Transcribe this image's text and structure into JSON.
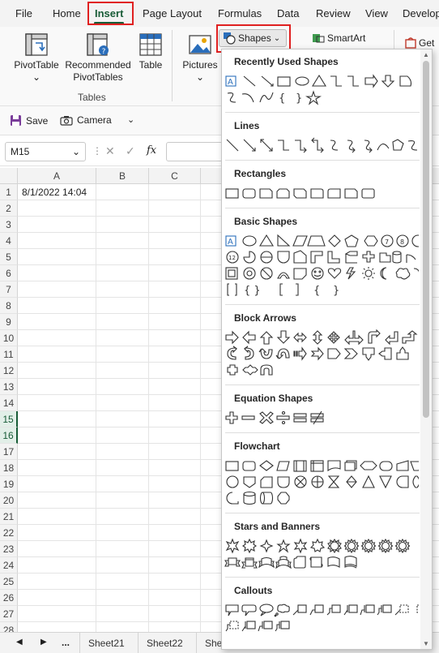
{
  "menu": {
    "file": "File",
    "home": "Home",
    "insert": "Insert",
    "page_layout": "Page Layout",
    "formulas": "Formulas",
    "data": "Data",
    "review": "Review",
    "view": "View",
    "developer": "Develop"
  },
  "ribbon": {
    "pivottable": "PivotTable",
    "recommended_1": "Recommended",
    "recommended_2": "PivotTables",
    "table": "Table",
    "tables_group": "Tables",
    "pictures": "Pictures",
    "shapes": "Shapes",
    "smartart": "SmartArt",
    "get": "Get"
  },
  "qat": {
    "save": "Save",
    "camera": "Camera"
  },
  "formula_bar": {
    "name_box": "M15",
    "fx": "fx"
  },
  "grid": {
    "columns": [
      "A",
      "B",
      "C"
    ],
    "rows": [
      "1",
      "2",
      "3",
      "4",
      "5",
      "6",
      "7",
      "8",
      "9",
      "10",
      "11",
      "12",
      "13",
      "14",
      "15",
      "16",
      "17",
      "18",
      "19",
      "20",
      "21",
      "22",
      "23",
      "24",
      "25",
      "26",
      "27",
      "28"
    ],
    "selected_rows": [
      "15",
      "16"
    ],
    "cell_a1": "8/1/2022 14:04"
  },
  "sheet_tabs": {
    "ellipsis": "...",
    "tabs": [
      "Sheet21",
      "Sheet22",
      "She"
    ]
  },
  "shapes_panel": {
    "sections": [
      "Recently Used Shapes",
      "Lines",
      "Rectangles",
      "Basic Shapes",
      "Block Arrows",
      "Equation Shapes",
      "Flowchart",
      "Stars and Banners",
      "Callouts"
    ]
  },
  "colors": {
    "excel_green": "#185c37",
    "highlight_red": "#e02020",
    "icon_blue": "#2a6ebb"
  }
}
